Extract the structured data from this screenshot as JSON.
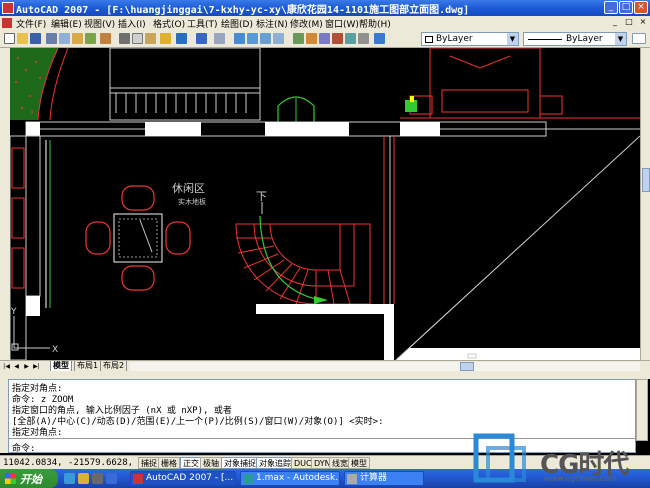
{
  "window": {
    "title": "AutoCAD 2007 - [F:\\huangjinggai\\7-kxhy-yc-xy\\康欣花园14-1101施工图部立面图.dwg]",
    "minimize": "_",
    "maximize": "□",
    "close": "×"
  },
  "menu": {
    "items": [
      "文件(F)",
      "编辑(E)",
      "视图(V)",
      "插入(I)",
      "格式(O)",
      "工具(T)",
      "绘图(D)",
      "标注(N)",
      "修改(M)",
      "窗口(W)",
      "帮助(H)"
    ],
    "doc_controls": [
      "_",
      "□",
      "×"
    ]
  },
  "toolbar": {
    "layer_color": "ByLayer",
    "linetype": "ByLayer",
    "dropdown_glyph": "▼"
  },
  "drawing": {
    "label_area": "休闲区",
    "label_floor": "实木地板",
    "label_down": "下",
    "axis_x": "X",
    "axis_y": "Y"
  },
  "tabs": {
    "nav": [
      "|◀",
      "◀",
      "▶",
      "▶|"
    ],
    "items": [
      "模型",
      "布局1",
      "布局2"
    ]
  },
  "command": {
    "lines": [
      "指定对角点:",
      "命令: z ZOOM",
      "指定窗口的角点, 输入比例因子 (nX 或 nXP), 或者",
      "[全部(A)/中心(C)/动态(D)/范围(E)/上一个(P)/比例(S)/窗口(W)/对象(O)] <实时>:",
      "指定对角点:"
    ],
    "prompt": "命令:"
  },
  "status": {
    "coords": "11042.0834, -21579.6628, 0.0000",
    "buttons": [
      "捕捉",
      "栅格",
      "正交",
      "极轴",
      "对象捕捉",
      "对象追踪",
      "DUCS",
      "DYN",
      "线宽",
      "模型"
    ],
    "active": [
      "正交",
      "对象捕捉",
      "对象追踪"
    ]
  },
  "taskbar": {
    "start": "开始",
    "tasks": [
      "AutoCAD 2007 - [...",
      "1.max - Autodesk...",
      "计算器"
    ]
  },
  "watermark": {
    "brand": "CG时代",
    "url": "www.cgtimes.com"
  }
}
